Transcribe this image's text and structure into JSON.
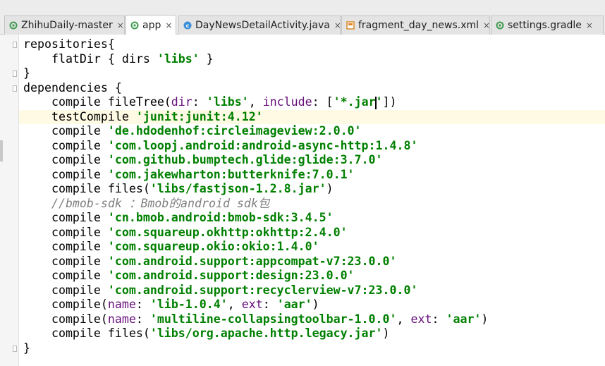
{
  "tabs": [
    {
      "label": "ZhihuDaily-master",
      "icon": "gradle-project-icon",
      "icon_color": "#3f9b4f",
      "active": false
    },
    {
      "label": "app",
      "icon": "gradle-module-icon",
      "icon_color": "#3f9b4f",
      "active": true
    },
    {
      "label": "DayNewsDetailActivity.java",
      "icon": "java-class-icon",
      "icon_color": "#3c8fd9",
      "active": false
    },
    {
      "label": "fragment_day_news.xml",
      "icon": "layout-xml-icon",
      "icon_color": "#d9892b",
      "active": false
    },
    {
      "label": "settings.gradle",
      "icon": "gradle-settings-icon",
      "icon_color": "#3f9b4f",
      "active": false
    }
  ],
  "tab_close_glyph": "×",
  "colors": {
    "string": "#008000",
    "param": "#660e7a",
    "comment": "#808080",
    "current_line": "#fffae3"
  },
  "editor": {
    "current_line_index": 5,
    "lines": [
      [
        {
          "t": "repositories{",
          "c": "plain"
        }
      ],
      [
        {
          "t": "    flatDir { dirs ",
          "c": "plain"
        },
        {
          "t": "'libs'",
          "c": "str"
        },
        {
          "t": " }",
          "c": "plain"
        }
      ],
      [
        {
          "t": "}",
          "c": "plain"
        }
      ],
      [
        {
          "t": "dependencies {",
          "c": "plain"
        }
      ],
      [
        {
          "t": "    compile fileTree(",
          "c": "plain"
        },
        {
          "t": "dir",
          "c": "param"
        },
        {
          "t": ": ",
          "c": "plain"
        },
        {
          "t": "'libs'",
          "c": "str"
        },
        {
          "t": ", ",
          "c": "plain"
        },
        {
          "t": "include",
          "c": "param"
        },
        {
          "t": ": [",
          "c": "plain"
        },
        {
          "t": "'*.jar",
          "c": "str"
        },
        {
          "t": "",
          "c": "caret"
        },
        {
          "t": "'",
          "c": "str"
        },
        {
          "t": "])",
          "c": "plain"
        }
      ],
      [
        {
          "t": "    testCompile ",
          "c": "plain"
        },
        {
          "t": "'junit:junit:4.12'",
          "c": "str"
        }
      ],
      [
        {
          "t": "    compile ",
          "c": "plain"
        },
        {
          "t": "'de.hdodenhof:circleimageview:2.0.0'",
          "c": "str"
        }
      ],
      [
        {
          "t": "    compile ",
          "c": "plain"
        },
        {
          "t": "'com.loopj.android:android-async-http:1.4.8'",
          "c": "str"
        }
      ],
      [
        {
          "t": "    compile ",
          "c": "plain"
        },
        {
          "t": "'com.github.bumptech.glide:glide:3.7.0'",
          "c": "str"
        }
      ],
      [
        {
          "t": "    compile ",
          "c": "plain"
        },
        {
          "t": "'com.jakewharton:butterknife:7.0.1'",
          "c": "str"
        }
      ],
      [
        {
          "t": "    compile files(",
          "c": "plain"
        },
        {
          "t": "'libs/fastjson-1.2.8.jar'",
          "c": "str"
        },
        {
          "t": ")",
          "c": "plain"
        }
      ],
      [
        {
          "t": "    //bmob-sdk ：Bmob的android sdk包",
          "c": "comment"
        }
      ],
      [
        {
          "t": "    compile ",
          "c": "plain"
        },
        {
          "t": "'cn.bmob.android:bmob-sdk:3.4.5'",
          "c": "str"
        }
      ],
      [
        {
          "t": "    compile ",
          "c": "plain"
        },
        {
          "t": "'com.squareup.okhttp:okhttp:2.4.0'",
          "c": "str"
        }
      ],
      [
        {
          "t": "    compile ",
          "c": "plain"
        },
        {
          "t": "'com.squareup.okio:okio:1.4.0'",
          "c": "str"
        }
      ],
      [
        {
          "t": "    compile ",
          "c": "plain"
        },
        {
          "t": "'com.android.support:appcompat-v7:23.0.0'",
          "c": "str"
        }
      ],
      [
        {
          "t": "    compile ",
          "c": "plain"
        },
        {
          "t": "'com.android.support:design:23.0.0'",
          "c": "str"
        }
      ],
      [
        {
          "t": "    compile ",
          "c": "plain"
        },
        {
          "t": "'com.android.support:recyclerview-v7:23.0.0'",
          "c": "str"
        }
      ],
      [
        {
          "t": "    compile(",
          "c": "plain"
        },
        {
          "t": "name",
          "c": "param"
        },
        {
          "t": ": ",
          "c": "plain"
        },
        {
          "t": "'lib-1.0.4'",
          "c": "str"
        },
        {
          "t": ", ",
          "c": "plain"
        },
        {
          "t": "ext",
          "c": "param"
        },
        {
          "t": ": ",
          "c": "plain"
        },
        {
          "t": "'aar'",
          "c": "str"
        },
        {
          "t": ")",
          "c": "plain"
        }
      ],
      [
        {
          "t": "    compile(",
          "c": "plain"
        },
        {
          "t": "name",
          "c": "param"
        },
        {
          "t": ": ",
          "c": "plain"
        },
        {
          "t": "'multiline-collapsingtoolbar-1.0.0'",
          "c": "str"
        },
        {
          "t": ", ",
          "c": "plain"
        },
        {
          "t": "ext",
          "c": "param"
        },
        {
          "t": ": ",
          "c": "plain"
        },
        {
          "t": "'aar'",
          "c": "str"
        },
        {
          "t": ")",
          "c": "plain"
        }
      ],
      [
        {
          "t": "    compile files(",
          "c": "plain"
        },
        {
          "t": "'libs/org.apache.http.legacy.jar'",
          "c": "str"
        },
        {
          "t": ")",
          "c": "plain"
        }
      ],
      [
        {
          "t": "}",
          "c": "plain"
        }
      ]
    ]
  }
}
